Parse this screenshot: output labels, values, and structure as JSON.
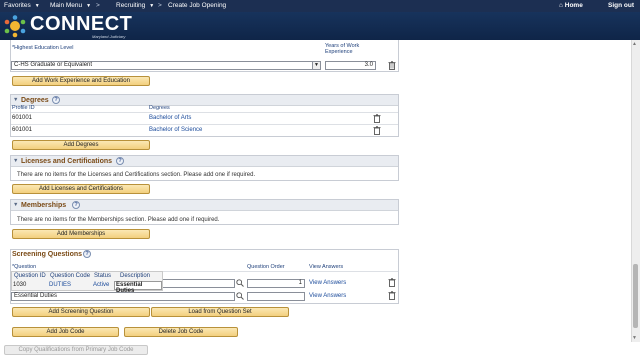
{
  "topbar": {
    "favorites": "Favorites",
    "main_menu": "Main Menu",
    "sep1": ">",
    "recruiting": "Recruiting",
    "sep2": ">",
    "create_job_opening": "Create Job Opening",
    "home": "Home",
    "sign_out": "Sign out"
  },
  "brand": {
    "name": "CONNECT",
    "sub": "Maryland Judiciary"
  },
  "education": {
    "level_header": "*Highest Education Level",
    "years_header": "Years of Work Experience",
    "level_value": "C-HS Graduate or Equivalent",
    "years_value": "3.0",
    "add_button": "Add Work Experience and Education"
  },
  "degrees": {
    "title": "Degrees",
    "col_profile_id": "Profile ID",
    "col_degrees": "Degrees",
    "rows": [
      {
        "profile_id": "601001",
        "degree": "Bachelor of Arts"
      },
      {
        "profile_id": "601001",
        "degree": "Bachelor of Science"
      }
    ],
    "add_button": "Add Degrees"
  },
  "licenses": {
    "title": "Licenses and Certifications",
    "message": "There are no items for the Licenses and Certifications section.  Please add one if required.",
    "add_button": "Add Licenses and Certifications"
  },
  "memberships": {
    "title": "Memberships",
    "message": "There are no items for the Memberships section.  Please add one if required.",
    "add_button": "Add Memberships"
  },
  "screening": {
    "title": "Screening Questions",
    "col_question": "*Question",
    "col_order": "Question Order",
    "col_answers": "View Answers",
    "popup": {
      "question_id_header": "Question ID",
      "question_code_header": "Question Code",
      "status_header": "Status",
      "description_header": "Description",
      "question_id": "1030",
      "question_code": "DUTIES",
      "status": "Active",
      "description": "Essential Duties"
    },
    "rows": [
      {
        "question": "",
        "order": "1",
        "answers": "View Answers"
      },
      {
        "question": "Essential Duties",
        "order": "",
        "answers": "View Answers"
      }
    ],
    "add_button": "Add Screening Question",
    "load_button": "Load from Question Set"
  },
  "job_code": {
    "add_button": "Add Job Code",
    "delete_button": "Delete Job Code",
    "copy_button": "Copy Qualifications from Primary Job Code"
  },
  "colors": {
    "topbar": "#1c2f52",
    "header": "#17335c",
    "button": "#f3cf7e",
    "section_title": "#7a4a16",
    "link": "#1a4a9a"
  }
}
